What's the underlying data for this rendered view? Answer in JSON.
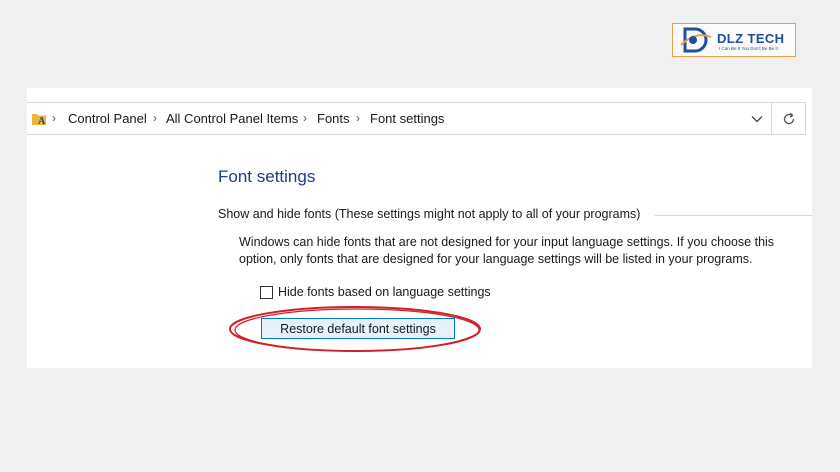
{
  "logo": {
    "name": "DLZ TECH",
    "tagline": "I Can Be It You Don't Be Be It",
    "accent": "#1f4e9a",
    "border": "#e7a14c"
  },
  "addressbar": {
    "breadcrumbs": [
      "Control Panel",
      "All Control Panel Items",
      "Fonts",
      "Font settings"
    ],
    "dropdown_icon": "chevron-down-icon",
    "refresh_icon": "refresh-icon"
  },
  "main": {
    "title": "Font settings",
    "section_label": "Show and hide fonts (These settings might not apply to all of your programs)",
    "description": "Windows can hide fonts that are not designed for your input language settings. If you choose this option, only fonts that are designed for your language settings will be listed in your programs.",
    "checkbox_label": "Hide fonts based on language settings",
    "checkbox_checked": false,
    "restore_button": "Restore default font settings"
  },
  "colors": {
    "title": "#1e3b8a",
    "button_bg": "#e5f1fb",
    "button_border": "#0078d7",
    "highlight": "#d0202a"
  }
}
